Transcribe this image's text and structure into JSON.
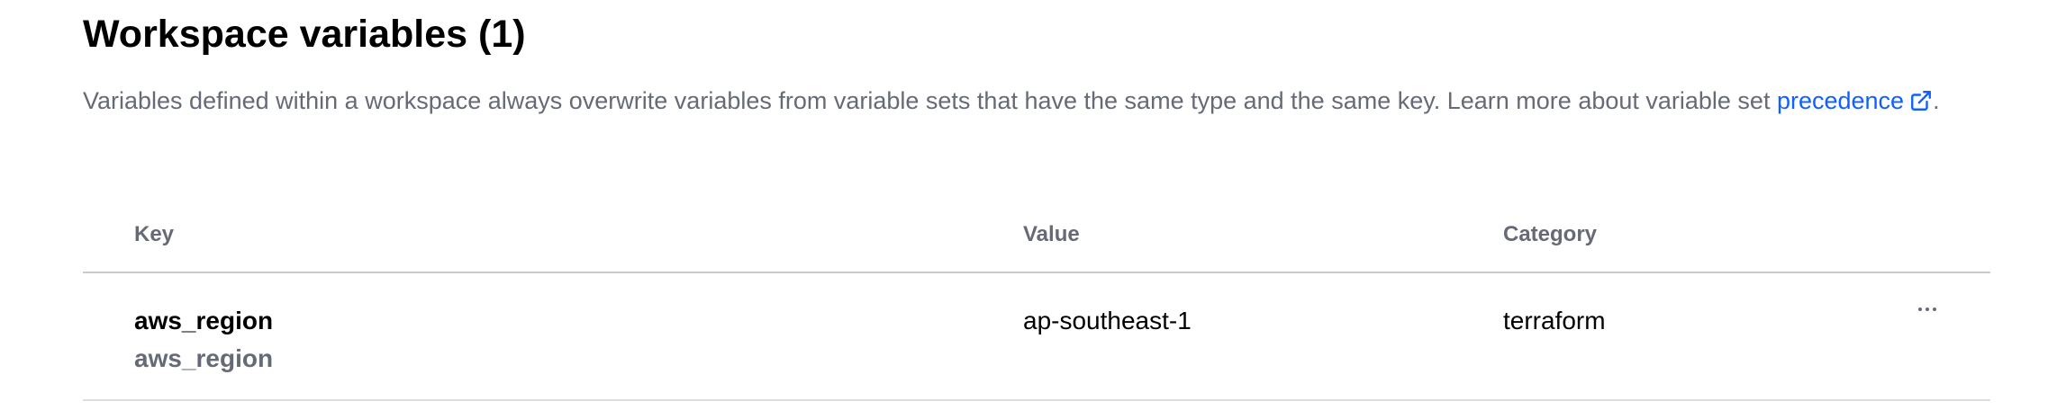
{
  "section": {
    "title": "Workspace variables (1)",
    "description_text": "Variables defined within a workspace always overwrite variables from variable sets that have the same type and the same key. Learn more about variable set ",
    "link_label": "precedence",
    "link_icon": "external-link-icon",
    "description_suffix": "."
  },
  "table": {
    "headers": {
      "key": "Key",
      "value": "Value",
      "category": "Category"
    },
    "rows": [
      {
        "key": "aws_region",
        "key_secondary": "aws_region",
        "value": "ap-southeast-1",
        "category": "terraform",
        "actions_icon": "more-horizontal-icon"
      }
    ]
  },
  "colors": {
    "heading": "#000000",
    "muted_text": "#656a76",
    "link": "#1060ff",
    "divider": "#c8cacf"
  }
}
